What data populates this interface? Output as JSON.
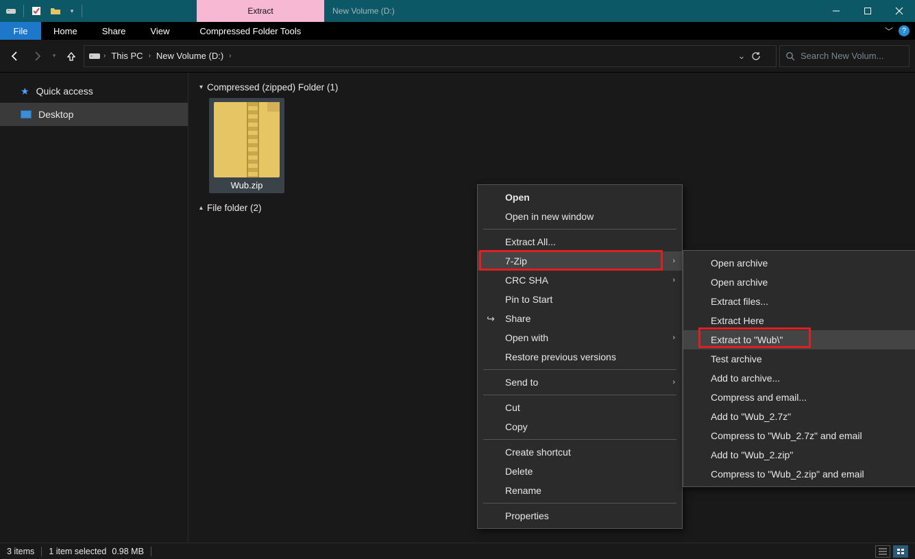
{
  "window": {
    "title": "New Volume (D:)",
    "contextual_tab": "Extract"
  },
  "ribbon": {
    "file": "File",
    "tabs": [
      "Home",
      "Share",
      "View"
    ],
    "tools_tab": "Compressed Folder Tools"
  },
  "breadcrumb": {
    "root": "This PC",
    "current": "New Volume (D:)"
  },
  "search": {
    "placeholder": "Search New Volum..."
  },
  "sidebar": {
    "quick_access": "Quick access",
    "desktop": "Desktop"
  },
  "content": {
    "group1": {
      "label": "Compressed (zipped) Folder (1)"
    },
    "group2": {
      "label": "File folder (2)"
    },
    "file": {
      "name": "Wub.zip"
    }
  },
  "context_menu": {
    "open": "Open",
    "open_new_window": "Open in new window",
    "extract_all": "Extract All...",
    "seven_zip": "7-Zip",
    "crc_sha": "CRC SHA",
    "pin_to_start": "Pin to Start",
    "share": "Share",
    "open_with": "Open with",
    "restore_prev": "Restore previous versions",
    "send_to": "Send to",
    "cut": "Cut",
    "copy": "Copy",
    "create_shortcut": "Create shortcut",
    "delete": "Delete",
    "rename": "Rename",
    "properties": "Properties"
  },
  "submenu_7zip": {
    "open_archive1": "Open archive",
    "open_archive2": "Open archive",
    "extract_files": "Extract files...",
    "extract_here": "Extract Here",
    "extract_to": "Extract to \"Wub\\\"",
    "test_archive": "Test archive",
    "add_to_archive": "Add to archive...",
    "compress_email": "Compress and email...",
    "add_7z": "Add to \"Wub_2.7z\"",
    "compress_7z_email": "Compress to \"Wub_2.7z\" and email",
    "add_zip": "Add to \"Wub_2.zip\"",
    "compress_zip_email": "Compress to \"Wub_2.zip\" and email"
  },
  "status": {
    "items": "3 items",
    "selected": "1 item selected",
    "size": "0.98 MB"
  }
}
